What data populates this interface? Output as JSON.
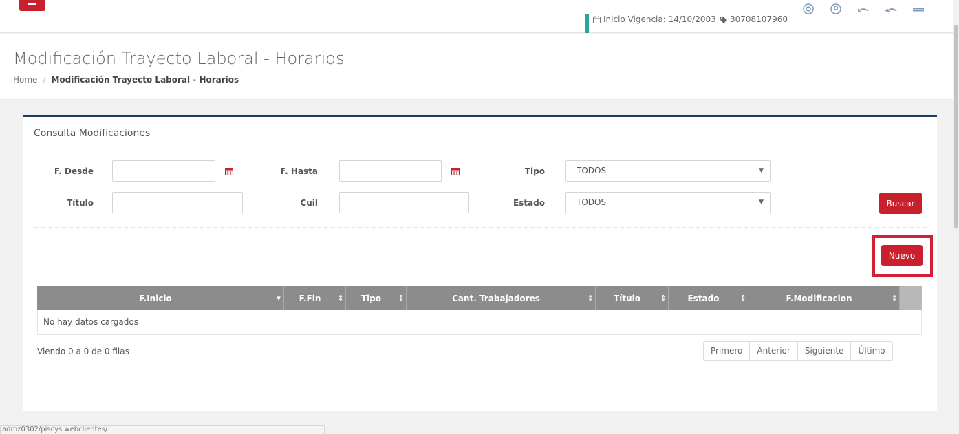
{
  "header": {
    "vigencia_label": "Inicio Vigencia: 14/10/2003",
    "cuit": "30708107960",
    "icons": [
      "target-icon",
      "user-circle-icon",
      "reply-icon",
      "reply-all-icon",
      "grid-icon"
    ]
  },
  "page": {
    "title": "Modificación Trayecto Laboral - Horarios",
    "breadcrumb": {
      "home": "Home",
      "separator": "/",
      "current": "Modificación Trayecto Laboral - Horarios"
    }
  },
  "panel": {
    "title": "Consulta Modificaciones",
    "filters": {
      "f_desde_label": "F. Desde",
      "f_desde_value": "",
      "f_hasta_label": "F. Hasta",
      "f_hasta_value": "",
      "tipo_label": "Tipo",
      "tipo_value": "TODOS",
      "titulo_label": "Título",
      "titulo_value": "",
      "cuil_label": "Cuil",
      "cuil_value": "",
      "estado_label": "Estado",
      "estado_value": "TODOS"
    },
    "buscar_label": "Buscar",
    "nuevo_label": "Nuevo"
  },
  "table": {
    "columns": [
      {
        "label": "F.Inicio",
        "sort": "▾"
      },
      {
        "label": "F.Fin",
        "sort": "⇕"
      },
      {
        "label": "Tipo",
        "sort": "⇕"
      },
      {
        "label": "Cant. Trabajadores",
        "sort": "⇕"
      },
      {
        "label": "Título",
        "sort": "⇕"
      },
      {
        "label": "Estado",
        "sort": "⇕"
      },
      {
        "label": "F.Modificacion",
        "sort": "⇕"
      }
    ],
    "empty_text": "No hay datos cargados",
    "info": "Viendo 0 a 0 de 0 filas",
    "pager": [
      "Primero",
      "Anterior",
      "Siguiente",
      "Último"
    ]
  },
  "statusbar": {
    "url": "admz0302/piscys.webclientes/"
  },
  "colors": {
    "accent_red": "#c9202e",
    "panel_border": "#1f3e64",
    "header_gray": "#8c8c8c",
    "teal": "#26a69a"
  }
}
